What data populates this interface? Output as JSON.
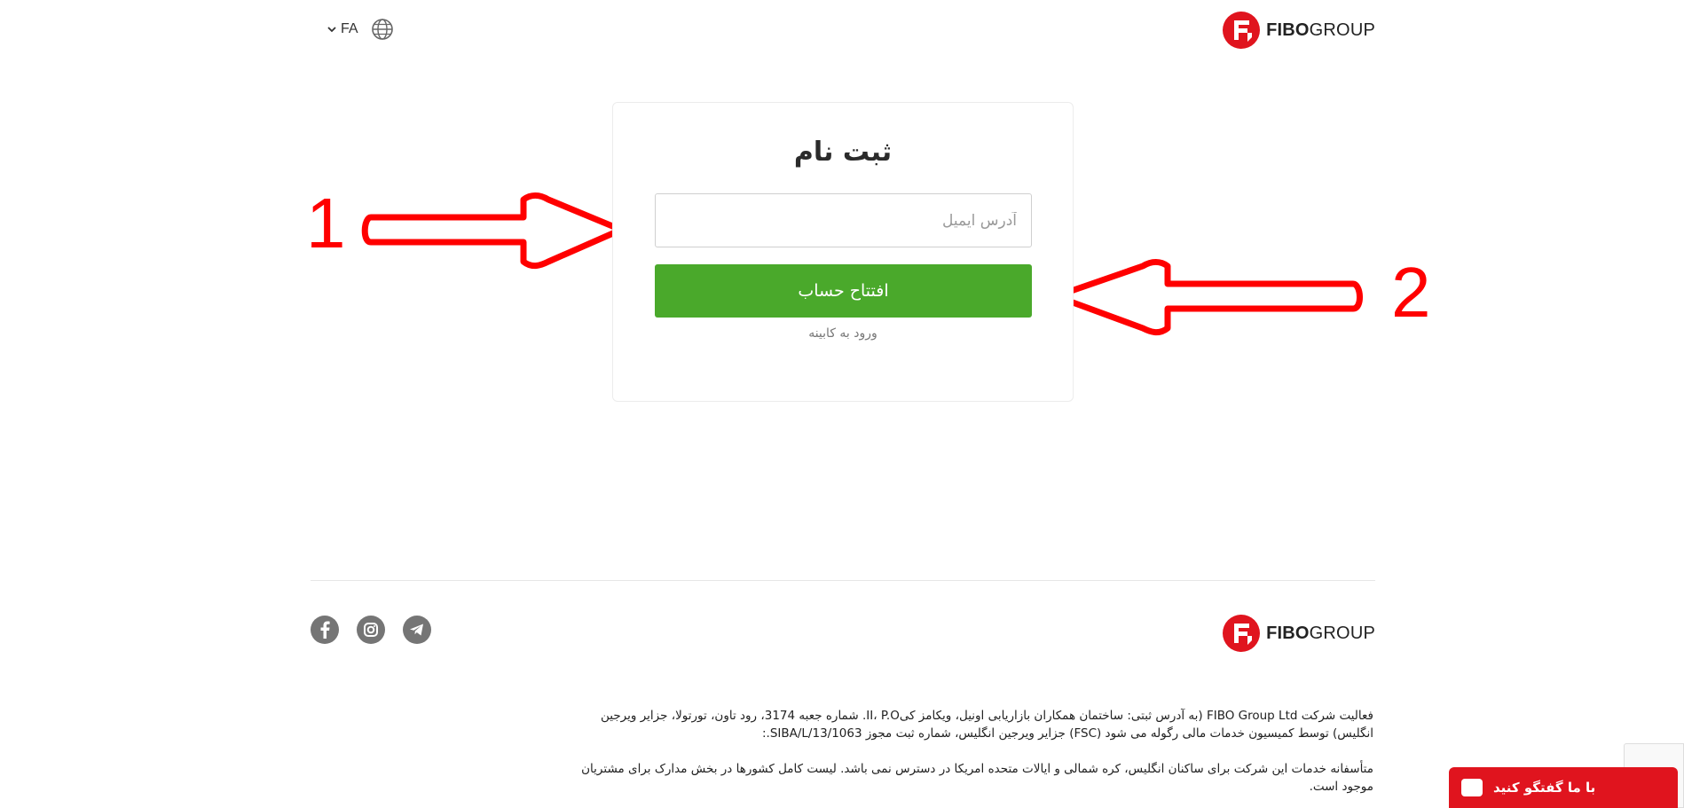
{
  "header": {
    "brand_bold": "FIBO",
    "brand_regular": "GROUP",
    "language": "FA"
  },
  "form": {
    "title": "ثبت نام",
    "email_placeholder": "آدرس ایمیل",
    "email_value": "",
    "submit_label": "افتتاح حساب",
    "login_link": "ورود به کابینه"
  },
  "annotations": {
    "label_1": "1",
    "label_2": "2"
  },
  "footer": {
    "brand_bold": "FIBO",
    "brand_regular": "GROUP",
    "social_icons": [
      "facebook-icon",
      "instagram-icon",
      "telegram-icon"
    ],
    "legal_1": "فعالیت شرکت FIBO Group Ltd (به آدرس ثبتی: ساختمان همکاران بازاریابی اونیل، ویکامز کیII، P.O. شماره جعبه 3174، رود تاون، تورتولا، جزایر ویرجین انگلیس) توسط کمیسیون خدمات مالی رگوله می شود (FSC) جزایر ویرجین انگلیس، شماره ثبت مجوز SIBA/L/13/1063.:",
    "legal_2": "متأسفانه خدمات این شرکت برای ساکنان انگلیس، کره شمالی و ایالات متحده امریکا در دسترس نمی باشد. لیست کامل کشورها در بخش مدارک برای مشتریان موجود است."
  },
  "chat": {
    "label": "با ما گفتگو کنید"
  },
  "colors": {
    "brand_red": "#e0141e",
    "cta_green": "#4aa92b",
    "annotation_red": "#ff0000"
  }
}
